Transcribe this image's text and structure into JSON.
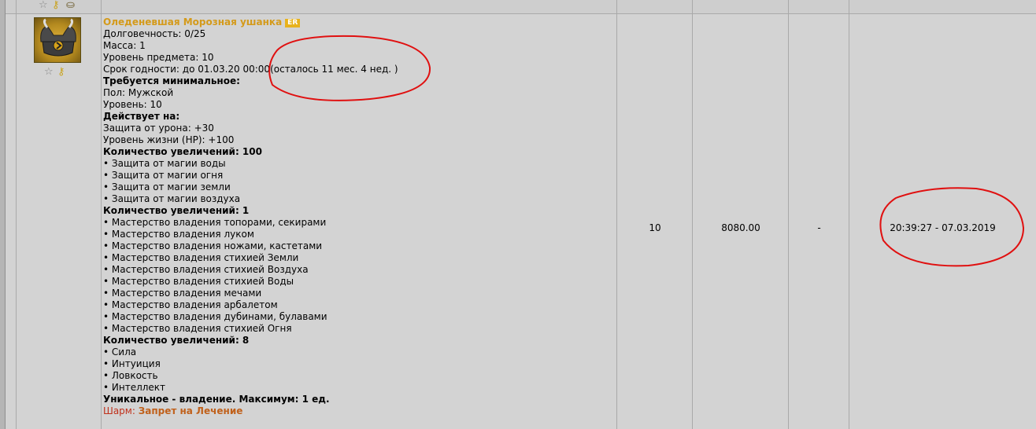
{
  "item": {
    "name": "Оледеневшая Морозная ушанка",
    "badge": "ER",
    "lines": {
      "durability": "Долговечность: 0/25",
      "mass": "Масса: 1",
      "item_level": "Уровень предмета: 10",
      "expiry": "Срок годности: до 01.03.20 00:00",
      "expiry_remaining": "(осталось 11 мес. 4 нед. )",
      "req_header": "Требуется минимальное:",
      "gender": "Пол: Мужской",
      "level": "Уровень: 10",
      "acts_header": "Действует на:",
      "damage_protection": "Защита от урона: +30",
      "hp": "Уровень жизни (HP): +100",
      "upgrades_100_header": "Количество увеличений: 100",
      "upgrades_1_header": "Количество увеличений: 1",
      "upgrades_8_header": "Количество увеличений: 8",
      "unique": "Уникальное - владение. Максимум: 1 ед.",
      "charm_label": "Шарм: ",
      "charm_value": "Запрет на Лечение"
    },
    "upgrades_100": [
      "• Защита от магии воды",
      "• Защита от магии огня",
      "• Защита от магии земли",
      "• Защита от магии воздуха"
    ],
    "upgrades_1": [
      "• Мастерство владения топорами, секирами",
      "• Мастерство владения луком",
      "• Мастерство владения ножами, кастетами",
      "• Мастерство владения стихией Земли",
      "• Мастерство владения стихией Воздуха",
      "• Мастерство владения стихией Воды",
      "• Мастерство владения мечами",
      "• Мастерство владения арбалетом",
      "• Мастерство владения дубинами, булавами",
      "• Мастерство владения стихией Огня"
    ],
    "upgrades_8": [
      "• Сила",
      "• Интуиция",
      "• Ловкость",
      "• Интеллект"
    ]
  },
  "columns": {
    "quantity": "10",
    "price": "8080.00",
    "dash": "-",
    "datetime": "20:39:27 - 07.03.2019"
  },
  "icons": [
    "star-icon",
    "key-icon",
    "bag-icon",
    "helmet-icon"
  ],
  "colors": {
    "item_name": "#d49a1a",
    "badge": "#e8b21c",
    "annotation": "#e01010",
    "charm": "#c0601a"
  }
}
